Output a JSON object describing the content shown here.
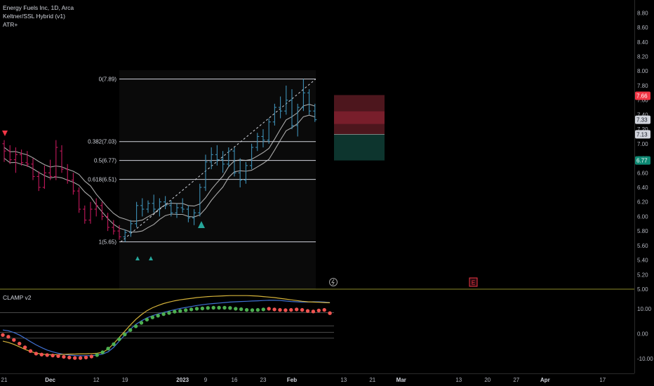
{
  "legend": {
    "title": "Energy Fuels Inc, 1D, Arca",
    "indicator_1": "Keltner/SSL Hybrid (v1)",
    "indicator_2": "ATR+",
    "oscillator": "CLAMP v2"
  },
  "colors": {
    "background": "#000000",
    "bull_bar": "#3d8fb5",
    "bear_bar": "#c2185b",
    "fib_line": "#d1d4dc",
    "envelope": "#bdbdbd",
    "stop_zone": "#5a1a22",
    "target_zone": "#0e3b33",
    "dot_green": "#4caf50",
    "dot_red": "#ef5350",
    "osc_blue": "#3f6fd0",
    "osc_yellow": "#d4b23a",
    "osc_gray": "#8a8a8a",
    "divider": "#8c8a2a"
  },
  "chart_data": [
    {
      "type": "ohlc",
      "title": "Energy Fuels Inc, 1D, Arca",
      "x_axis": {
        "tick_labels": [
          "21",
          "Dec",
          "12",
          "19",
          "2023",
          "9",
          "16",
          "23",
          "Feb",
          "13",
          "21",
          "Mar",
          "13",
          "20",
          "27",
          "Apr",
          "17"
        ],
        "tick_bar_index": [
          0,
          8,
          16,
          21,
          31,
          35,
          40,
          45,
          50,
          59,
          64,
          69,
          79,
          84,
          89,
          94,
          104
        ]
      },
      "y_axis": {
        "range": [
          5.0,
          8.9
        ],
        "tick_labels": [
          "8.80",
          "8.60",
          "8.40",
          "8.20",
          "8.00",
          "7.80",
          "7.60",
          "7.40",
          "7.20",
          "7.00",
          "6.80",
          "6.60",
          "6.40",
          "6.20",
          "6.00",
          "5.80",
          "5.60",
          "5.40",
          "5.20",
          "5.00"
        ],
        "tick_values": [
          8.8,
          8.6,
          8.4,
          8.2,
          8.0,
          7.8,
          7.6,
          7.4,
          7.2,
          7.0,
          6.8,
          6.6,
          6.4,
          6.2,
          6.0,
          5.8,
          5.6,
          5.4,
          5.2,
          5.0
        ],
        "price_badges": [
          {
            "label": "7.66",
            "value": 7.66,
            "color": "#f23645"
          },
          {
            "label": "7.33",
            "value": 7.33,
            "color": "#d1d4dc"
          },
          {
            "label": "7.13",
            "value": 7.13,
            "color": "#d1d4dc"
          },
          {
            "label": "6.77",
            "value": 6.77,
            "color": "#0e8a74"
          }
        ]
      },
      "ohlc": [
        [
          7.0,
          7.05,
          6.75,
          6.9
        ],
        [
          6.9,
          6.98,
          6.72,
          6.78
        ],
        [
          6.78,
          6.95,
          6.6,
          6.85
        ],
        [
          6.85,
          6.92,
          6.7,
          6.74
        ],
        [
          6.74,
          6.9,
          6.68,
          6.72
        ],
        [
          6.72,
          6.8,
          6.5,
          6.55
        ],
        [
          6.55,
          6.62,
          6.35,
          6.4
        ],
        [
          6.4,
          6.7,
          6.38,
          6.6
        ],
        [
          6.6,
          6.78,
          6.5,
          6.55
        ],
        [
          6.55,
          7.05,
          6.5,
          6.95
        ],
        [
          6.9,
          6.98,
          6.6,
          6.65
        ],
        [
          6.65,
          6.72,
          6.45,
          6.5
        ],
        [
          6.5,
          6.6,
          6.3,
          6.35
        ],
        [
          6.35,
          6.4,
          6.05,
          6.1
        ],
        [
          6.1,
          6.15,
          5.9,
          5.95
        ],
        [
          5.95,
          6.2,
          5.9,
          6.1
        ],
        [
          6.1,
          6.25,
          6.0,
          6.15
        ],
        [
          6.15,
          6.2,
          5.95,
          6.0
        ],
        [
          6.0,
          6.05,
          5.8,
          5.85
        ],
        [
          5.85,
          5.95,
          5.75,
          5.8
        ],
        [
          5.8,
          5.88,
          5.68,
          5.72
        ],
        [
          5.72,
          5.82,
          5.65,
          5.78
        ],
        [
          5.78,
          5.95,
          5.72,
          5.9
        ],
        [
          5.9,
          6.2,
          5.85,
          6.15
        ],
        [
          6.15,
          6.25,
          6.0,
          6.1
        ],
        [
          6.1,
          6.22,
          6.05,
          6.18
        ],
        [
          6.18,
          6.3,
          6.05,
          6.1
        ],
        [
          6.1,
          6.25,
          6.0,
          6.2
        ],
        [
          6.2,
          6.28,
          6.1,
          6.15
        ],
        [
          6.15,
          6.22,
          6.0,
          6.05
        ],
        [
          6.05,
          6.18,
          5.98,
          6.12
        ],
        [
          6.12,
          6.25,
          6.05,
          6.1
        ],
        [
          6.1,
          6.15,
          5.92,
          5.98
        ],
        [
          5.98,
          6.1,
          5.88,
          6.05
        ],
        [
          6.05,
          6.45,
          6.0,
          6.4
        ],
        [
          6.4,
          6.85,
          6.35,
          6.75
        ],
        [
          6.75,
          6.95,
          6.65,
          6.85
        ],
        [
          6.85,
          6.98,
          6.7,
          6.78
        ],
        [
          6.78,
          6.9,
          6.6,
          6.72
        ],
        [
          6.72,
          6.95,
          6.68,
          6.9
        ],
        [
          6.9,
          6.95,
          6.55,
          6.6
        ],
        [
          6.6,
          6.8,
          6.4,
          6.5
        ],
        [
          6.5,
          6.75,
          6.45,
          6.7
        ],
        [
          6.7,
          7.0,
          6.65,
          6.95
        ],
        [
          6.95,
          7.15,
          6.9,
          7.1
        ],
        [
          7.1,
          7.2,
          6.95,
          7.05
        ],
        [
          7.05,
          7.35,
          7.0,
          7.3
        ],
        [
          7.3,
          7.55,
          7.25,
          7.5
        ],
        [
          7.5,
          7.65,
          7.35,
          7.45
        ],
        [
          7.45,
          7.8,
          7.4,
          7.6
        ],
        [
          7.6,
          7.75,
          7.2,
          7.25
        ],
        [
          7.25,
          7.55,
          7.1,
          7.5
        ],
        [
          7.5,
          7.89,
          7.45,
          7.7
        ],
        [
          7.7,
          7.75,
          7.4,
          7.45
        ],
        [
          7.45,
          7.55,
          7.3,
          7.33
        ]
      ],
      "fibonacci": [
        {
          "label": "0(7.89)",
          "level": 0,
          "price": 7.89
        },
        {
          "label": "0.382(7.03)",
          "level": 0.382,
          "price": 7.03
        },
        {
          "label": "0.5(6.77)",
          "level": 0.5,
          "price": 6.77
        },
        {
          "label": "0.618(6.51)",
          "level": 0.618,
          "price": 6.51
        },
        {
          "label": "1(5.65)",
          "level": 1,
          "price": 5.65
        }
      ],
      "risk_reward": {
        "stop": 7.66,
        "entry": 7.13,
        "target": 6.77
      }
    },
    {
      "type": "oscillator",
      "title": "CLAMP v2",
      "y_axis": {
        "range": [
          -16,
          18
        ],
        "tick_labels": [
          "10.00",
          "0.00",
          "-10.00"
        ],
        "tick_values": [
          10,
          0,
          -10
        ]
      },
      "dots": [
        -0.5,
        -1.2,
        -2.5,
        -4.0,
        -5.5,
        -7.0,
        -8.0,
        -8.4,
        -8.6,
        -8.8,
        -9.0,
        -9.3,
        -9.6,
        -9.8,
        -9.8,
        -9.6,
        -9.2,
        -8.6,
        -7.5,
        -6.0,
        -4.2,
        -2.2,
        -0.3,
        1.5,
        3.0,
        4.4,
        5.7,
        6.6,
        7.3,
        7.9,
        8.4,
        8.9,
        9.2,
        9.5,
        9.8,
        10.1,
        10.2,
        10.4,
        10.5,
        10.5,
        10.5,
        10.4,
        10.1,
        9.9,
        9.6,
        9.5,
        9.6,
        9.8,
        10.1,
        9.8,
        9.6,
        9.5,
        9.6,
        9.8,
        9.6,
        9.2,
        9.0,
        9.4,
        9.6,
        8.3
      ],
      "dot_colors": [
        "red",
        "red",
        "red",
        "red",
        "red",
        "red",
        "red",
        "red",
        "red",
        "red",
        "red",
        "red",
        "red",
        "red",
        "red",
        "red",
        "red",
        "green",
        "green",
        "green",
        "green",
        "green",
        "green",
        "green",
        "green",
        "green",
        "green",
        "green",
        "green",
        "green",
        "green",
        "green",
        "green",
        "green",
        "green",
        "green",
        "green",
        "green",
        "green",
        "green",
        "green",
        "green",
        "green",
        "green",
        "green",
        "green",
        "green",
        "green",
        "red",
        "red",
        "red",
        "red",
        "red",
        "red",
        "red",
        "red",
        "red",
        "red",
        "red",
        "red"
      ],
      "blue_line": [
        1.5,
        1.2,
        0.5,
        -0.5,
        -1.8,
        -3.2,
        -4.5,
        -5.6,
        -6.6,
        -7.3,
        -7.9,
        -8.3,
        -8.6,
        -8.8,
        -8.9,
        -8.9,
        -8.8,
        -8.6,
        -8.2,
        -7.3,
        -5.5,
        -3.0,
        -0.5,
        1.8,
        3.8,
        5.2,
        6.4,
        7.3,
        8.0,
        8.6,
        9.2,
        9.7,
        10.2,
        10.6,
        11.0,
        11.4,
        11.7,
        12.0,
        12.2,
        12.4,
        12.6,
        12.8,
        12.9,
        13.0,
        13.1,
        13.2,
        13.3,
        13.4,
        13.5,
        13.5,
        13.4,
        13.2,
        13.0,
        12.9,
        12.8,
        12.8,
        12.9,
        12.9,
        12.8,
        12.6
      ],
      "yellow_line": [
        -3.0,
        -3.5,
        -4.3,
        -5.3,
        -6.3,
        -7.2,
        -7.8,
        -8.2,
        -8.4,
        -8.5,
        -8.4,
        -8.3,
        -8.2,
        -8.2,
        -8.1,
        -8.1,
        -8.0,
        -7.9,
        -7.5,
        -6.2,
        -4.0,
        -1.5,
        1.0,
        3.5,
        5.8,
        7.7,
        9.3,
        10.5,
        11.4,
        12.2,
        12.8,
        13.3,
        13.7,
        14.0,
        14.3,
        14.6,
        14.8,
        15.0,
        15.1,
        15.2,
        15.3,
        15.4,
        15.4,
        15.4,
        15.4,
        15.3,
        15.2,
        15.0,
        14.8,
        14.6,
        14.3,
        14.0,
        13.7,
        13.4,
        13.1,
        12.9,
        12.8,
        12.7,
        12.6,
        12.5
      ],
      "level_lines": [
        8.5,
        3.2,
        0.6,
        -1.8
      ]
    }
  ]
}
